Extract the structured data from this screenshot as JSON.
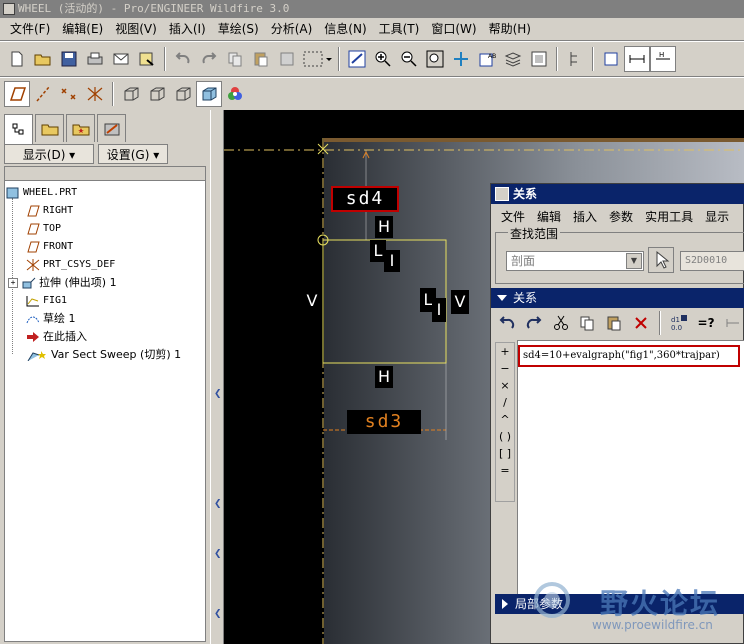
{
  "window": {
    "title": "WHEEL (活动的) - Pro/ENGINEER Wildfire 3.0"
  },
  "menu": [
    "文件(F)",
    "编辑(E)",
    "视图(V)",
    "插入(I)",
    "草绘(S)",
    "分析(A)",
    "信息(N)",
    "工具(T)",
    "窗口(W)",
    "帮助(H)"
  ],
  "panel": {
    "show_label": "显示(D) ▾",
    "settings_label": "设置(G) ▾",
    "tree": [
      {
        "label": "WHEEL.PRT",
        "icon": "part-icon",
        "mono": true
      },
      {
        "label": "RIGHT",
        "icon": "datum-plane-icon",
        "mono": true
      },
      {
        "label": "TOP",
        "icon": "datum-plane-icon",
        "mono": true
      },
      {
        "label": "FRONT",
        "icon": "datum-plane-icon",
        "mono": true
      },
      {
        "label": "PRT_CSYS_DEF",
        "icon": "csys-icon",
        "mono": true
      },
      {
        "label": "拉伸 (伸出项) 1",
        "icon": "extrude-icon",
        "mono": false
      },
      {
        "label": "FIG1",
        "icon": "graph-icon",
        "mono": true
      },
      {
        "label": "草绘 1",
        "icon": "sketch-icon",
        "mono": false
      },
      {
        "label": "在此插入",
        "icon": "insert-here-arrow-icon",
        "mono": false
      },
      {
        "label": "Var Sect Sweep (切剪) 1",
        "icon": "var-sect-sweep-icon",
        "mono": false
      }
    ]
  },
  "canvas": {
    "dim_sd4": "sd4",
    "dim_sd3": "sd3",
    "label_h_top": "H",
    "label_h_bottom": "H",
    "label_v_left": "V",
    "label_v_right": "V",
    "label_l_top": "L",
    "label_l_right": "L",
    "label_i_top": "I",
    "label_i_right": "I"
  },
  "dialog": {
    "title": "关系",
    "menu": [
      "文件",
      "编辑",
      "插入",
      "参数",
      "实用工具",
      "显示"
    ],
    "scope_label": "查找范围",
    "scope_select": "剖面",
    "scope_value": "S2D0010",
    "relations_header": "关系",
    "ops": [
      "+",
      "−",
      "×",
      "/",
      "^",
      "( )",
      "[ ]",
      "="
    ],
    "equals_query_label": "=?",
    "relation_text": "sd4=10+evalgraph(\"fig1\",360*trajpar)",
    "local_params_label": "局部参数"
  },
  "watermark": {
    "text": "野火论坛",
    "url": "www.proewildfire.cn"
  },
  "colors": {
    "title_bar_active": "#0a246a",
    "highlight_red": "#c00000",
    "sketch_yellow": "#e8e060",
    "dim_orange": "#e08020"
  }
}
